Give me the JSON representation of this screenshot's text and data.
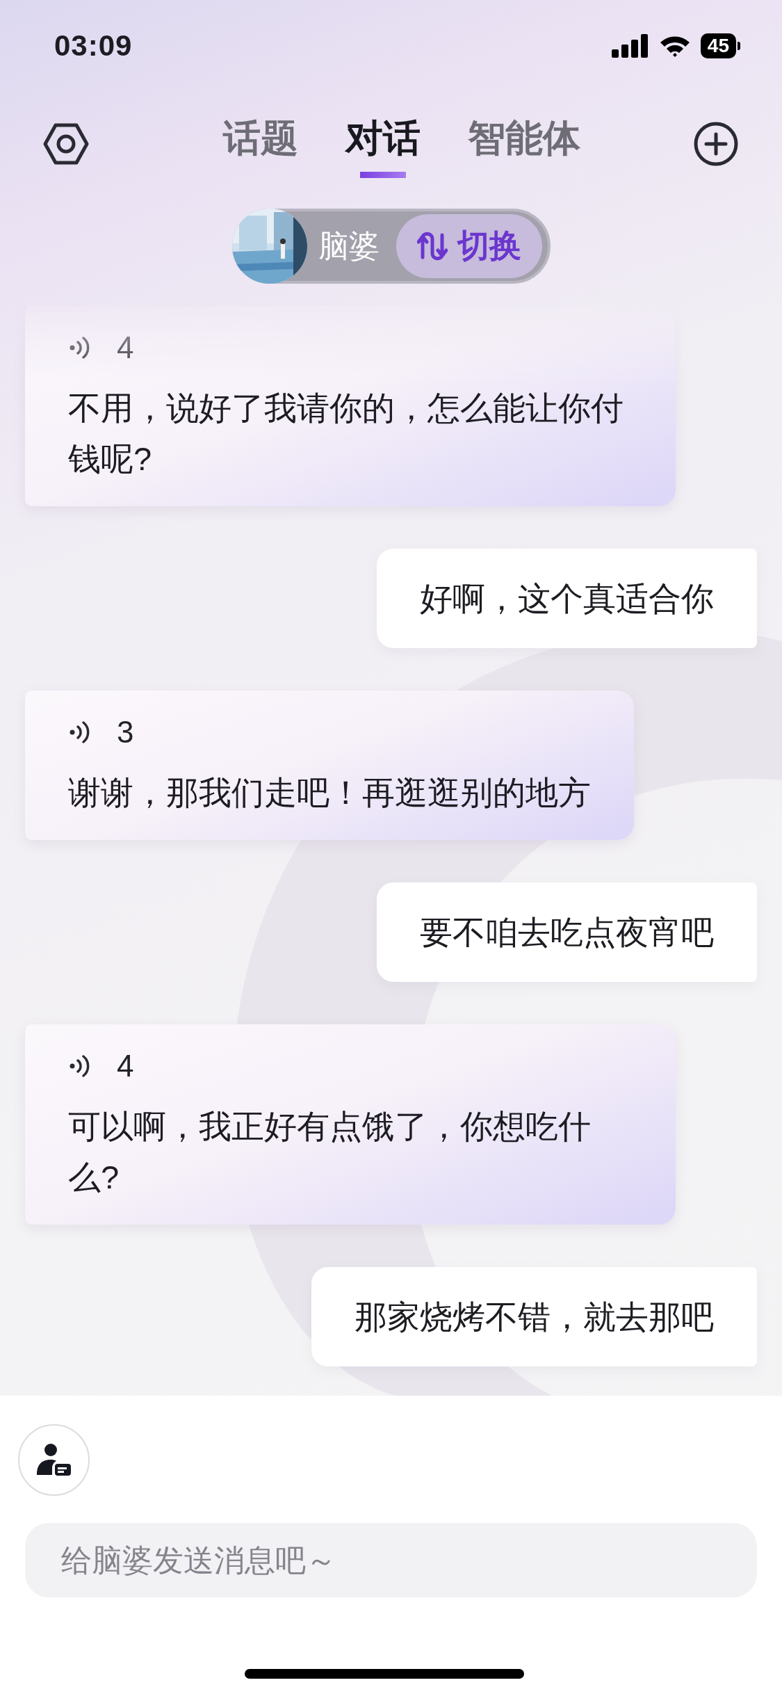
{
  "status_bar": {
    "time": "03:09",
    "battery": "45"
  },
  "header": {
    "tabs": [
      {
        "label": "话题",
        "selected": false
      },
      {
        "label": "对话",
        "selected": true
      },
      {
        "label": "智能体",
        "selected": false
      }
    ]
  },
  "agent_switch": {
    "name": "脑婆",
    "button": "切换"
  },
  "messages": [
    {
      "kind": "bot",
      "voice_count": "4",
      "text": "不用，说好了我请你的，怎么能让你付钱呢?"
    },
    {
      "kind": "user",
      "text": "好啊，这个真适合你"
    },
    {
      "kind": "bot",
      "voice_count": "3",
      "text": "谢谢，那我们走吧！再逛逛别的地方"
    },
    {
      "kind": "user",
      "text": "要不咱去吃点夜宵吧"
    },
    {
      "kind": "bot",
      "voice_count": "4",
      "text": "可以啊，我正好有点饿了，你想吃什么?"
    },
    {
      "kind": "user",
      "text": "那家烧烤不错，就去那吧"
    }
  ],
  "composer": {
    "placeholder": "给脑婆发送消息吧～"
  }
}
